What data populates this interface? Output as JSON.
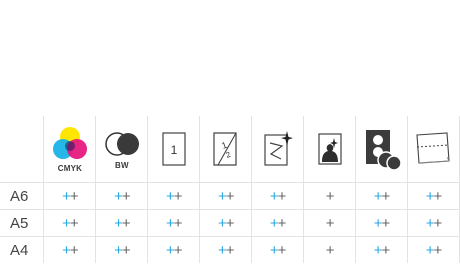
{
  "columns": [
    {
      "id": "cmyk",
      "label": "CMYK",
      "icon": "cmyk-circles-icon"
    },
    {
      "id": "bw",
      "label": "BW",
      "icon": "bw-circles-icon"
    },
    {
      "id": "one-sided",
      "label": "",
      "icon_text": "1",
      "icon": "single-page-icon"
    },
    {
      "id": "two-sided",
      "label": "",
      "icon_text": "1/2",
      "icon": "duplex-page-icon"
    },
    {
      "id": "sparkle",
      "label": "",
      "icon": "sparkle-page-icon"
    },
    {
      "id": "photo",
      "label": "",
      "icon": "photo-silhouette-icon"
    },
    {
      "id": "doc-dots",
      "label": "",
      "icon": "document-dots-icon"
    },
    {
      "id": "perforated",
      "label": "",
      "icon": "perforated-page-icon"
    }
  ],
  "rows": [
    {
      "size": "A6",
      "cells": [
        {
          "blue": "+",
          "gray": "+"
        },
        {
          "blue": "+",
          "gray": "+"
        },
        {
          "blue": "+",
          "gray": "+"
        },
        {
          "blue": "+",
          "gray": "+"
        },
        {
          "blue": "+",
          "gray": "+"
        },
        {
          "blue": "",
          "gray": "+"
        },
        {
          "blue": "+",
          "gray": "+"
        },
        {
          "blue": "+",
          "gray": "+"
        }
      ]
    },
    {
      "size": "A5",
      "cells": [
        {
          "blue": "+",
          "gray": "+"
        },
        {
          "blue": "+",
          "gray": "+"
        },
        {
          "blue": "+",
          "gray": "+"
        },
        {
          "blue": "+",
          "gray": "+"
        },
        {
          "blue": "+",
          "gray": "+"
        },
        {
          "blue": "",
          "gray": "+"
        },
        {
          "blue": "+",
          "gray": "+"
        },
        {
          "blue": "+",
          "gray": "+"
        }
      ]
    },
    {
      "size": "A4",
      "cells": [
        {
          "blue": "+",
          "gray": "+"
        },
        {
          "blue": "+",
          "gray": "+"
        },
        {
          "blue": "+",
          "gray": "+"
        },
        {
          "blue": "+",
          "gray": "+"
        },
        {
          "blue": "+",
          "gray": "+"
        },
        {
          "blue": "",
          "gray": "+"
        },
        {
          "blue": "+",
          "gray": "+"
        },
        {
          "blue": "+",
          "gray": "+"
        }
      ]
    }
  ],
  "colors": {
    "accent": "#29a8e0",
    "cyan": "#19b3e6",
    "magenta": "#e6197d",
    "yellow": "#ffe600",
    "grid": "#e3e3e3"
  }
}
